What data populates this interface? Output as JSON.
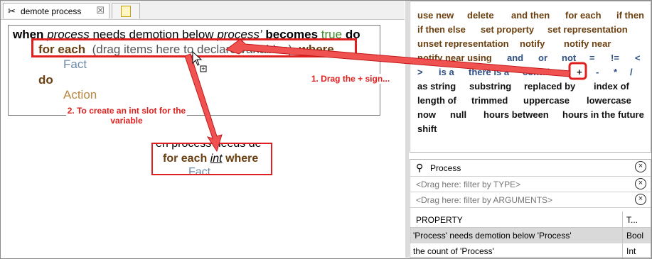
{
  "editor": {
    "tabs": [
      {
        "label": "demote process",
        "close": "☒"
      }
    ],
    "rule": {
      "when": "when",
      "process1": "process",
      "needs": "needs demotion below",
      "process2": "process’",
      "becomes": "becomes",
      "true": "true",
      "do1": "do",
      "for_each": "for each",
      "drag_hint": "(drag items here to declare variables)",
      "where": "where",
      "fact": "Fact",
      "do2": "do",
      "action": "Action"
    },
    "preview": {
      "top": "en process needs de",
      "for_each": "for each",
      "int": "int",
      "where": "where",
      "fact": "Fact"
    }
  },
  "annotations": {
    "drag_plus": "1. Drag the + sign...",
    "create_slot": "2. To create an int slot for the variable"
  },
  "palette": {
    "items": [
      "use new",
      "delete",
      "and then",
      "for each",
      "if then",
      "if then else",
      "set property",
      "set representation",
      "unset representation",
      "notify",
      "notify near",
      "notify near using",
      "and",
      "or",
      "not",
      "=",
      "!=",
      "<",
      ">",
      "is a",
      "there is a",
      "contains",
      "+",
      "-",
      "*",
      "/",
      "as string",
      "substring",
      "replaced by",
      "index of",
      "length of",
      "trimmed",
      "uppercase",
      "lowercase",
      "now",
      "null",
      "hours between",
      "hours in the future",
      "shift"
    ]
  },
  "finder": {
    "search_value": "Process",
    "type_filter": "<Drag here: filter by TYPE>",
    "args_filter": "<Drag here: filter by ARGUMENTS>",
    "columns": [
      "PROPERTY",
      "T..."
    ],
    "rows": [
      {
        "property": "'Process' needs demotion below 'Process'",
        "type": "Bool",
        "selected": true
      },
      {
        "property": "the count of 'Process'",
        "type": "Int",
        "selected": false
      }
    ]
  },
  "colors": {
    "highlight": "#e0201e",
    "keyword": "#6b3f0f",
    "operator": "#2d4f82"
  }
}
